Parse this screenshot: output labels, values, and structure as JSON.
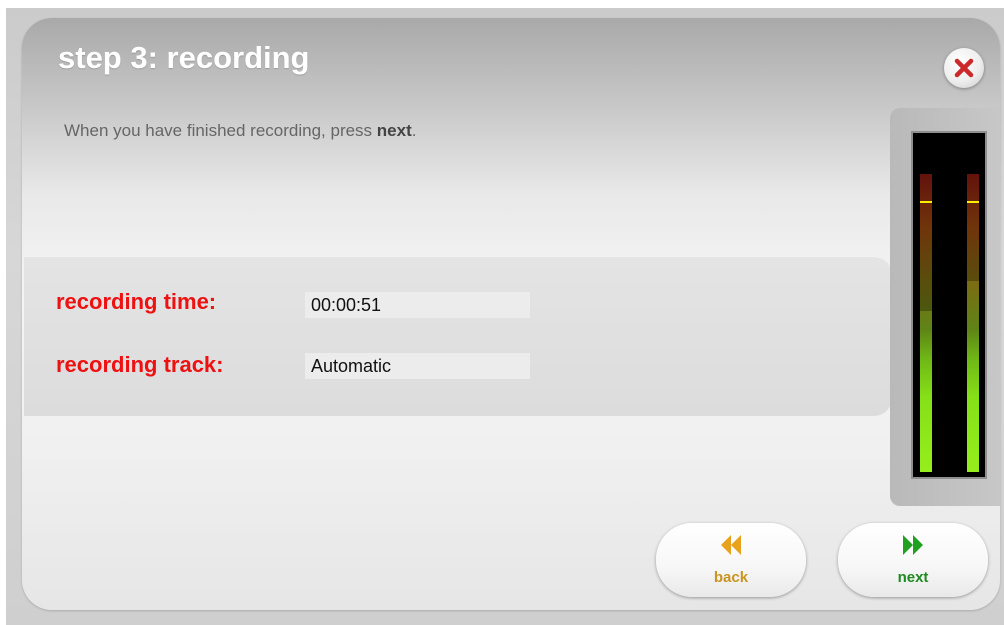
{
  "header": {
    "title": "step 3: recording"
  },
  "instruction": {
    "text": "When you have finished recording, press ",
    "emphasis": "next",
    "suffix": "."
  },
  "fields": {
    "time_label": "recording time:",
    "time_value": "00:00:51",
    "track_label": "recording track:",
    "track_value": "Automatic"
  },
  "level_meter": {
    "left_level": 0.54,
    "right_level": 0.64,
    "left_peak": 0.91,
    "right_peak": 0.91
  },
  "buttons": {
    "back_label": "back",
    "next_label": "next"
  },
  "icons": {
    "close": "close-icon",
    "back": "rewind-icon",
    "next": "fast-forward-icon"
  },
  "colors": {
    "accent_red": "#ee1111",
    "back_orange": "#e8a21c",
    "next_green": "#1fa11f",
    "meter_green": "#8fe81a"
  }
}
